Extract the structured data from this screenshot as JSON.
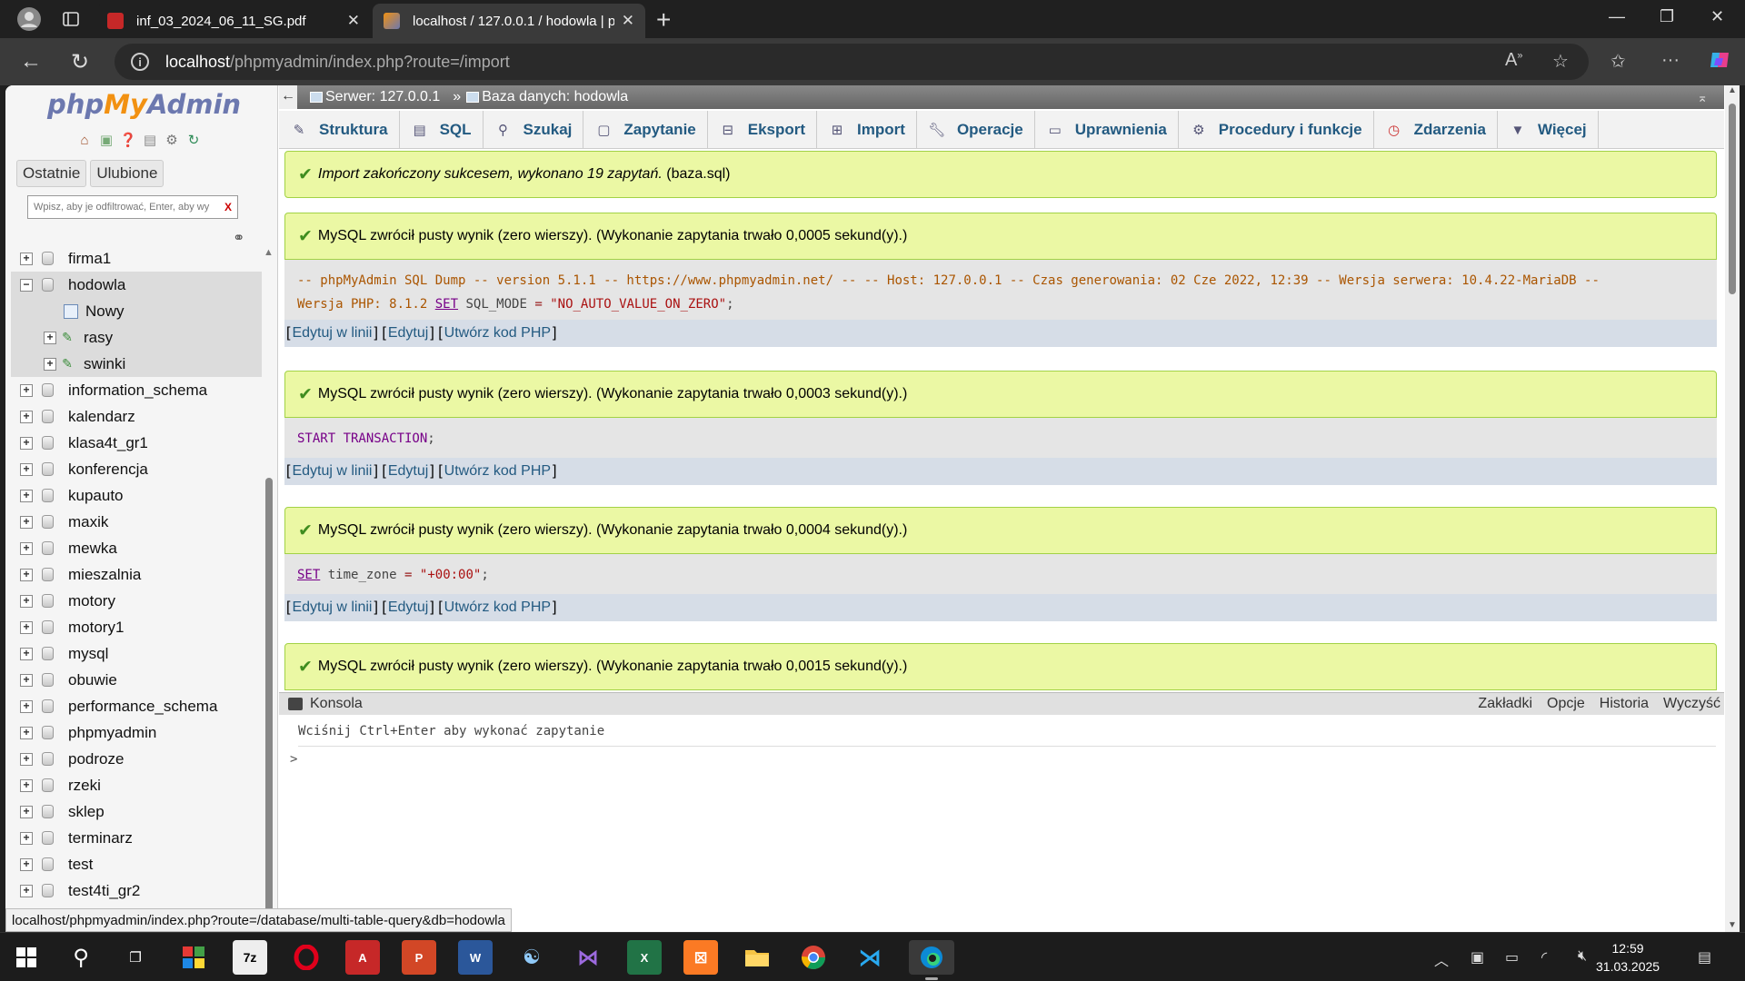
{
  "browser": {
    "tabs": [
      {
        "title": "inf_03_2024_06_11_SG.pdf",
        "active": false
      },
      {
        "title": "localhost / 127.0.0.1 / hodowla | p",
        "active": true
      }
    ],
    "url_host": "localhost",
    "url_path": "/phpmyadmin/index.php?route=/import"
  },
  "sidebar": {
    "logo": {
      "php": "php",
      "my": "My",
      "admin": "Admin"
    },
    "tabs": [
      "Ostatnie",
      "Ulubione"
    ],
    "filter_placeholder": "Wpisz, aby je odfiltrować, Enter, aby wy",
    "filter_clear": "X",
    "databases": [
      {
        "name": "firma1",
        "expanded": false
      },
      {
        "name": "hodowla",
        "expanded": true,
        "children": [
          "Nowy",
          "rasy",
          "swinki"
        ]
      },
      {
        "name": "information_schema",
        "expanded": false
      },
      {
        "name": "kalendarz",
        "expanded": false
      },
      {
        "name": "klasa4t_gr1",
        "expanded": false
      },
      {
        "name": "konferencja",
        "expanded": false
      },
      {
        "name": "kupauto",
        "expanded": false
      },
      {
        "name": "maxik",
        "expanded": false
      },
      {
        "name": "mewka",
        "expanded": false
      },
      {
        "name": "mieszalnia",
        "expanded": false
      },
      {
        "name": "motory",
        "expanded": false
      },
      {
        "name": "motory1",
        "expanded": false
      },
      {
        "name": "mysql",
        "expanded": false
      },
      {
        "name": "obuwie",
        "expanded": false
      },
      {
        "name": "performance_schema",
        "expanded": false
      },
      {
        "name": "phpmyadmin",
        "expanded": false
      },
      {
        "name": "podroze",
        "expanded": false
      },
      {
        "name": "rzeki",
        "expanded": false
      },
      {
        "name": "sklep",
        "expanded": false
      },
      {
        "name": "terminarz",
        "expanded": false
      },
      {
        "name": "test",
        "expanded": false
      },
      {
        "name": "test4ti_gr2",
        "expanded": false
      }
    ]
  },
  "breadcrumb": {
    "server": "Serwer: 127.0.0.1",
    "separator": "»",
    "database": "Baza danych: hodowla"
  },
  "menu": [
    "Struktura",
    "SQL",
    "Szukaj",
    "Zapytanie",
    "Eksport",
    "Import",
    "Operacje",
    "Uprawnienia",
    "Procedury i funkcje",
    "Zdarzenia",
    "Więcej"
  ],
  "import_result": {
    "message": "Import zakończony sukcesem, wykonano 19 zapytań.",
    "file": "(baza.sql)"
  },
  "queries": [
    {
      "message": "MySQL zwrócił pusty wynik (zero wierszy). (Wykonanie zapytania trwało 0,0005 sekund(y).)",
      "comment": "-- phpMyAdmin SQL Dump -- version 5.1.1 -- https://www.phpmyadmin.net/ -- -- Host: 127.0.0.1 -- Czas generowania: 02 Cze 2022, 12:39 -- Wersja serwera: 10.4.22-MariaDB --",
      "comment2": "Wersja PHP: 8.1.2",
      "keyword": "SET",
      "ident": "SQL_MODE",
      "op": "=",
      "value": "\"NO_AUTO_VALUE_ON_ZERO\"",
      "end": ";"
    },
    {
      "message": "MySQL zwrócił pusty wynik (zero wierszy). (Wykonanie zapytania trwało 0,0003 sekund(y).)",
      "keyword": "START TRANSACTION",
      "end": ";"
    },
    {
      "message": "MySQL zwrócił pusty wynik (zero wierszy). (Wykonanie zapytania trwało 0,0004 sekund(y).)",
      "keyword": "SET",
      "ident": "time_zone",
      "op": "=",
      "value": "\"+00:00\"",
      "end": ";"
    },
    {
      "message": "MySQL zwrócił pusty wynik (zero wierszy). (Wykonanie zapytania trwało 0,0015 sekund(y).)"
    }
  ],
  "query_tools": {
    "edit_inline": "Edytuj w linii",
    "edit": "Edytuj",
    "php": "Utwórz kod PHP",
    "open": "[",
    "close": "]"
  },
  "console": {
    "title": "Konsola",
    "actions": [
      "Zakładki",
      "Opcje",
      "Historia",
      "Wyczyść"
    ],
    "hint": "Wciśnij Ctrl+Enter aby wykonać zapytanie",
    "prompt": ">"
  },
  "status_url": "localhost/phpmyadmin/index.php?route=/database/multi-table-query&db=hodowla",
  "taskbar": {
    "time": "12:59",
    "date": "31.03.2025"
  }
}
